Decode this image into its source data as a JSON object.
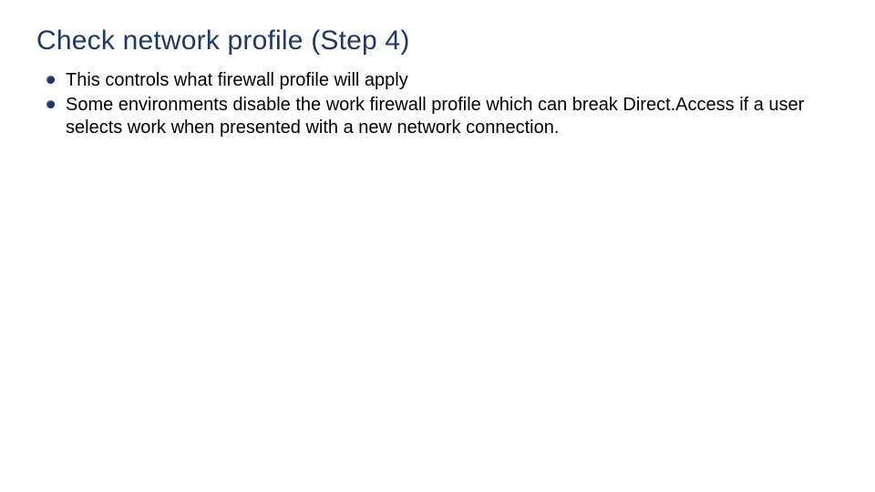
{
  "slide": {
    "title": "Check network profile (Step 4)",
    "bullets": [
      "This controls what firewall profile will apply",
      "Some environments disable the work firewall profile which can break Direct.Access if a user selects work when presented with a new network connection."
    ]
  }
}
